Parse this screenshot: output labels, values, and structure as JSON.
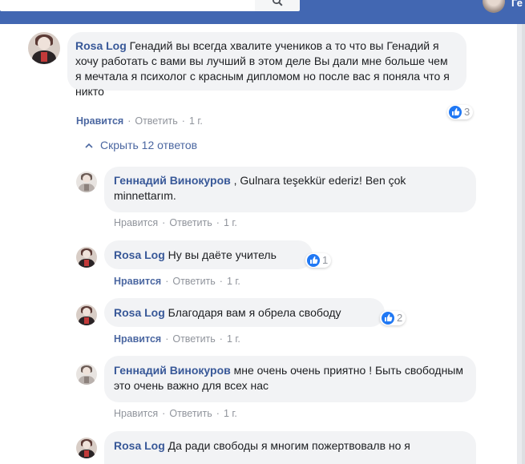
{
  "header": {
    "user_name_partial": "Ге"
  },
  "colors": {
    "brand": "#4267b2",
    "link": "#385898",
    "like_blue": "#2078f4",
    "bubble": "#f2f3f5",
    "muted": "#90949c"
  },
  "thread": {
    "main_comment": {
      "author": "Rosa Log",
      "text": "Генадий вы всегда хвалите учеников а то что вы Генадий я хочу работать с вами вы лучший в этом деле Вы дали мне больше чем я мечтала я психолог с красным дипломом но после вас я поняла что я никто",
      "like_label": "Нравится",
      "reply_label": "Ответить",
      "time": "1 г.",
      "reaction_count": "3"
    },
    "hide_replies_label": "Скрыть 12 ответов",
    "replies": [
      {
        "author": "Геннадий Винокуров",
        "text": ", Gulnara teşekkür ederiz! Ben çok minnettarım.",
        "like_label": "Нравится",
        "reply_label": "Ответить",
        "time": "1 г.",
        "reaction_count": ""
      },
      {
        "author": "Rosa Log",
        "text": "Ну вы даёте учитель",
        "like_label": "Нравится",
        "reply_label": "Ответить",
        "time": "1 г.",
        "reaction_count": "1"
      },
      {
        "author": "Rosa Log",
        "text": "Благодаря вам я обрела свободу",
        "like_label": "Нравится",
        "reply_label": "Ответить",
        "time": "1 г.",
        "reaction_count": "2"
      },
      {
        "author": "Геннадий Винокуров",
        "text": "мне очень очень приятно ! Быть свободным это очень важно для всех нас",
        "like_label": "Нравится",
        "reply_label": "Ответить",
        "time": "1 г.",
        "reaction_count": ""
      },
      {
        "author": "Rosa Log",
        "text": "Да ради свободы я многим пожертвовалв но я",
        "like_label": "",
        "reply_label": "",
        "time": "",
        "reaction_count": ""
      }
    ]
  }
}
